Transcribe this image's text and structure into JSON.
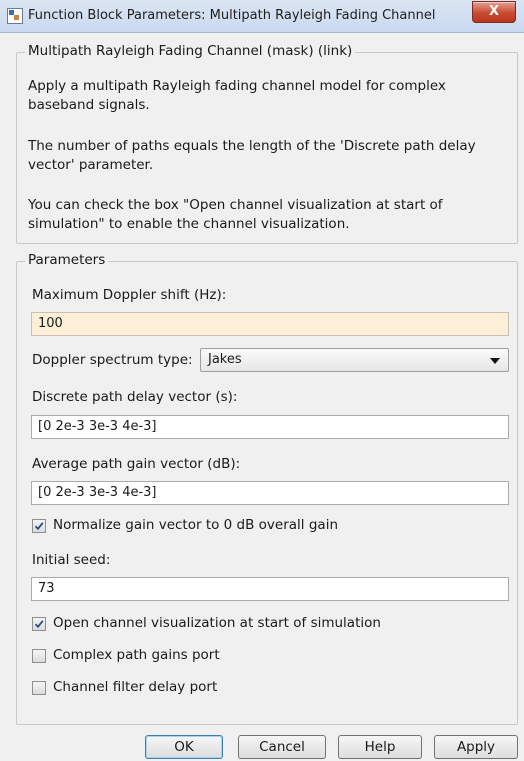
{
  "window": {
    "title": "Function Block Parameters: Multipath Rayleigh Fading Channel",
    "close_glyph": "X",
    "icon": "simulink-block-icon"
  },
  "mask": {
    "legend": "Multipath Rayleigh Fading Channel (mask) (link)",
    "paragraphs": [
      "Apply a multipath Rayleigh fading channel model for complex baseband signals.",
      "The number of paths equals the length of the 'Discrete path delay vector' parameter.",
      "You can check the box \"Open channel visualization at start of simulation\" to enable the channel visualization."
    ]
  },
  "parameters": {
    "legend": "Parameters",
    "doppler_shift": {
      "label": "Maximum Doppler shift (Hz):",
      "value": "100"
    },
    "doppler_spectrum": {
      "label": "Doppler spectrum type:",
      "value": "Jakes"
    },
    "path_delay": {
      "label": "Discrete path delay vector (s):",
      "value": "[0 2e-3 3e-3 4e-3]"
    },
    "path_gain": {
      "label": "Average path gain vector (dB):",
      "value": "[0 2e-3 3e-3 4e-3]"
    },
    "normalize": {
      "label": "Normalize gain vector to 0 dB overall gain",
      "checked": true
    },
    "initial_seed": {
      "label": "Initial seed:",
      "value": "73"
    },
    "open_visualization": {
      "label": "Open channel visualization at start of simulation",
      "checked": true
    },
    "complex_path_gains": {
      "label": "Complex path gains port",
      "checked": false
    },
    "channel_filter_delay": {
      "label": "Channel filter delay port",
      "checked": false
    }
  },
  "buttons": {
    "ok": "OK",
    "cancel": "Cancel",
    "help": "Help",
    "apply": "Apply"
  },
  "colors": {
    "focused_field": "#fdefd8",
    "close_button": "#c84a31",
    "default_button_border": "#3c7fb1"
  }
}
